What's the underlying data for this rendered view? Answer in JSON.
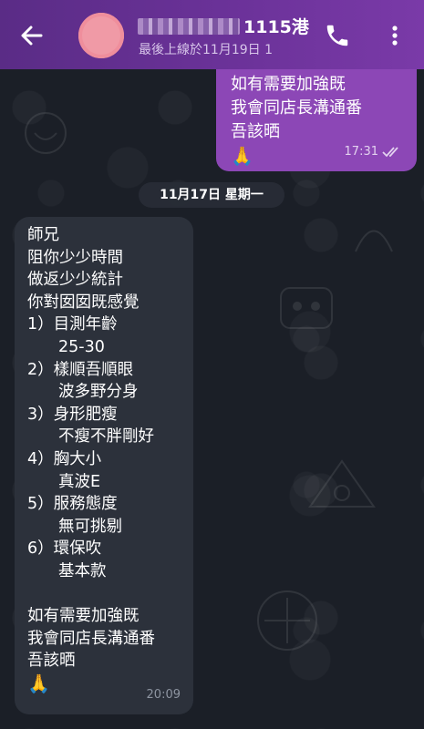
{
  "header": {
    "back_icon": "arrow-left-icon",
    "name_suffix": "1115港",
    "status": "最後上線於11月19日 1",
    "call_icon": "phone-icon",
    "more_icon": "more-vertical-icon",
    "avatar_color": "#f09aa6"
  },
  "messages": {
    "outgoing": {
      "lines": [
        "如有需要加強既",
        "我會同店長溝通番",
        "吾該晒"
      ],
      "emoji": "🙏",
      "time": "17:31",
      "status_icon": "double-check-icon",
      "color": "#8c47b6"
    },
    "date_separator": "11月17日 星期一",
    "incoming": {
      "lines": [
        "師兄",
        "阻你少少時間",
        "做返少少統計",
        "你對囡囡既感覺",
        "1）目測年齡",
        "25-30",
        "2）樣順吾順眼",
        "波多野分身",
        "3）身形肥瘦",
        "不瘦不胖剛好",
        "4）胸大小",
        "真波E",
        "5）服務態度",
        "無可挑剔",
        "6）環保吹",
        "基本款",
        "",
        "如有需要加強既",
        "我會同店長溝通番",
        "吾該晒"
      ],
      "emoji": "🙏",
      "time": "20:09",
      "color": "#2c313b"
    }
  }
}
